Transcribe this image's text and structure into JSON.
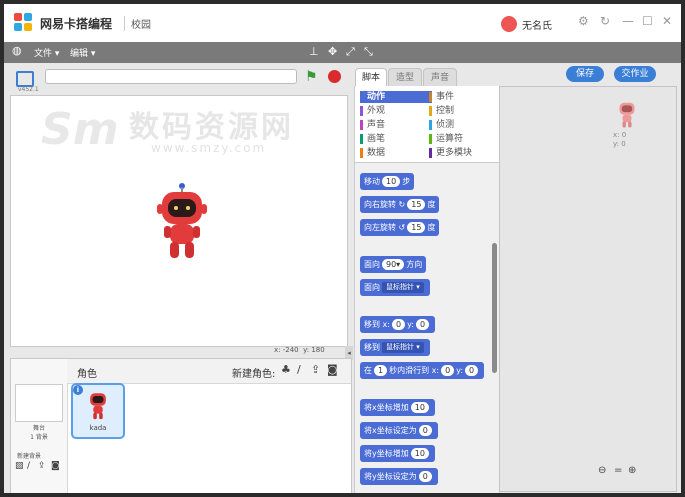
{
  "titlebar": {
    "app_title": "网易卡搭编程",
    "campus": "校园",
    "user_name": "无名氏",
    "controls": [
      "settings-icon",
      "refresh-icon",
      "minimize-icon",
      "maximize-icon",
      "close-icon"
    ]
  },
  "menubar": {
    "globe": "globe-icon",
    "file": "文件 ▾",
    "edit": "编辑 ▾",
    "tools": [
      "stamp-icon",
      "expand-icon",
      "grow-icon",
      "shrink-icon"
    ]
  },
  "stage": {
    "version": "v452.1",
    "watermark_cn": "数码资源网",
    "watermark_url": "www.smzy.com",
    "coord_x_label": "x:",
    "coord_x": "-240",
    "coord_y_label": "y:",
    "coord_y": "180"
  },
  "sprites": {
    "header": "角色",
    "new_sprite": "新建角色:",
    "stage_name": "舞台",
    "stage_bg_count": "1 背景",
    "new_backdrop": "新建背景",
    "sprite_name": "kada"
  },
  "tabs": [
    "脚本",
    "造型",
    "声音"
  ],
  "buttons": {
    "save": "保存",
    "homework": "交作业"
  },
  "categories": [
    {
      "label": "动作",
      "color": "#4a6cd4",
      "selected": true
    },
    {
      "label": "事件",
      "color": "#c88330"
    },
    {
      "label": "外观",
      "color": "#8a55d7"
    },
    {
      "label": "控制",
      "color": "#e1a91a"
    },
    {
      "label": "声音",
      "color": "#bb42c3"
    },
    {
      "label": "侦测",
      "color": "#2ca5e2"
    },
    {
      "label": "画笔",
      "color": "#0e9a6c"
    },
    {
      "label": "运算符",
      "color": "#5cb712"
    },
    {
      "label": "数据",
      "color": "#ee7d16"
    },
    {
      "label": "更多模块",
      "color": "#632d99"
    }
  ],
  "blocks": {
    "move": {
      "pre": "移动",
      "val": "10",
      "post": "步"
    },
    "turn_right": {
      "pre": "向右旋转",
      "val": "15",
      "post": "度"
    },
    "turn_left": {
      "pre": "向左旋转",
      "val": "15",
      "post": "度"
    },
    "point_dir": {
      "pre": "面向",
      "val": "90▾",
      "post": "方向"
    },
    "point_towards": {
      "pre": "面向",
      "val": "鼠标指针 ▾"
    },
    "goto_xy": {
      "pre": "移到 x:",
      "x": "0",
      "mid": "y:",
      "y": "0"
    },
    "goto": {
      "pre": "移到",
      "val": "鼠标指针 ▾"
    },
    "glide": {
      "pre": "在",
      "secs": "1",
      "mid": "秒内滑行到 x:",
      "x": "0",
      "mid2": "y:",
      "y": "0"
    },
    "change_x": {
      "pre": "将x坐标增加",
      "val": "10"
    },
    "set_x": {
      "pre": "将x坐标设定为",
      "val": "0"
    },
    "change_y": {
      "pre": "将y坐标增加",
      "val": "10"
    },
    "set_y": {
      "pre": "将y坐标设定为",
      "val": "0"
    }
  },
  "script_area": {
    "sprite_x": "x: 0",
    "sprite_y": "y: 0"
  }
}
